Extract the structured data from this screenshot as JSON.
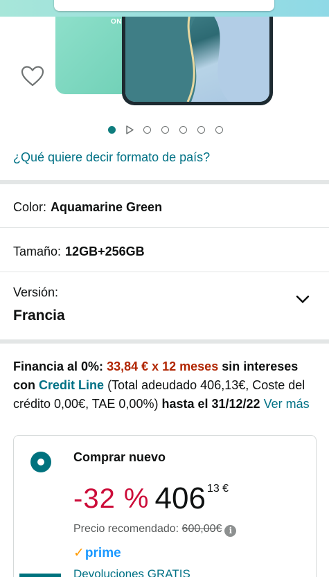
{
  "hero": {
    "brand_text": "ON",
    "favorite_icon": "heart-outline-icon",
    "accent_color": "#0f7d7e"
  },
  "carousel": {
    "dot_count": 7,
    "active_index": 0,
    "video_index": 1
  },
  "format_link": "¿Qué quiere decir formato de país?",
  "color": {
    "label": "Color:",
    "value": "Aquamarine Green"
  },
  "size": {
    "label": "Tamaño:",
    "value": "12GB+256GB"
  },
  "version": {
    "label": "Versión:",
    "value": "Francia",
    "expand_icon": "chevron-down-icon"
  },
  "finance": {
    "prefix": "Financia al 0%:",
    "amount": "33,84 € x 12 meses",
    "mid": "sin intereses con",
    "provider": "Credit Line",
    "details": "(Total adeudado 406,13€, Coste del crédito 0,00€, TAE 0,00%)",
    "until": "hasta el 31/12/22",
    "more_link": "Ver más"
  },
  "buy_box": {
    "title": "Comprar nuevo",
    "discount": "-32 %",
    "price_whole": "406",
    "price_fraction": "13 €",
    "reco_label": "Precio recomendado:",
    "reco_price": "600,00€",
    "prime_check": "✓",
    "prime_label": "prime",
    "returns": "Devoluciones GRATIS"
  },
  "colors": {
    "link": "#007185",
    "discount": "#cc0c39",
    "finance_amount": "#b12704",
    "prime": "#1a98ff",
    "radio": "#00727e"
  }
}
